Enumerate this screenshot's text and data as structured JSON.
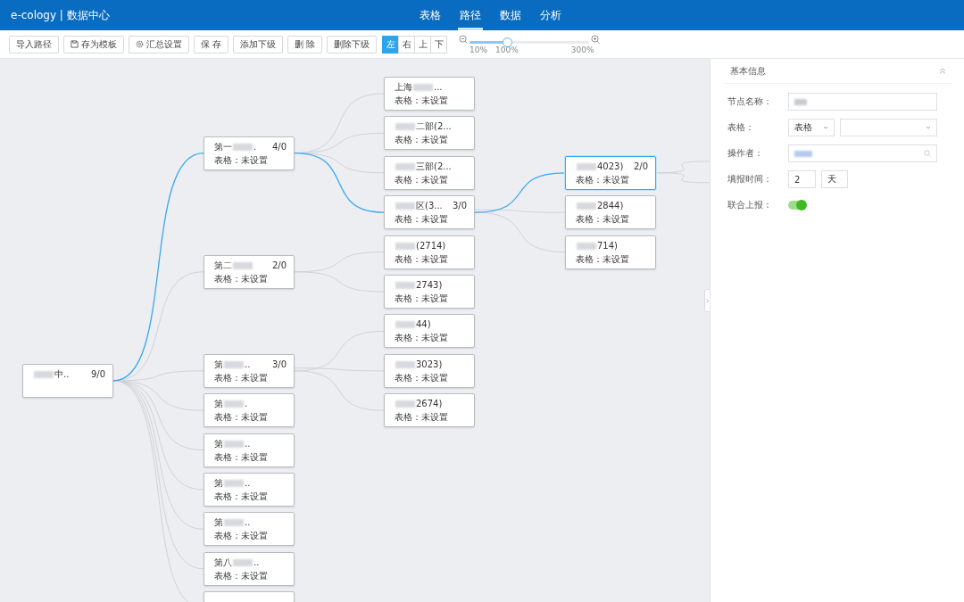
{
  "header": {
    "title": "e-cology | 数据中心",
    "tabs": [
      {
        "label": "表格",
        "selected": false
      },
      {
        "label": "路径",
        "selected": true
      },
      {
        "label": "数据",
        "selected": false
      },
      {
        "label": "分析",
        "selected": false
      }
    ]
  },
  "toolbar": {
    "buttons": [
      {
        "label": "导入路径"
      },
      {
        "label": "存为模板"
      },
      {
        "label": "汇总设置"
      },
      {
        "label": "保 存"
      },
      {
        "label": "添加下级"
      },
      {
        "label": "删 除"
      },
      {
        "label": "删除下级"
      }
    ],
    "directions": [
      {
        "label": "左",
        "selected": true
      },
      {
        "label": "右",
        "selected": false
      },
      {
        "label": "上",
        "selected": false
      },
      {
        "label": "下",
        "selected": false
      }
    ],
    "zoom": {
      "level": 0.31,
      "ticks": [
        "10%",
        "100%",
        "300%"
      ]
    }
  },
  "tree": {
    "redacted": true,
    "suffix": "中..",
    "count": "9/0",
    "selected": false,
    "children": [
      {
        "prefix": "第一",
        "redacted": true,
        "suffix": ".",
        "count": "4/0",
        "table": "表格：未设置",
        "selected": false,
        "on_path": true,
        "children": [
          {
            "prefix": "上海",
            "redacted": true,
            "suffix": "...",
            "table": "表格：未设置",
            "selected": false,
            "on_path": false
          },
          {
            "redacted": true,
            "suffix": "二部(2...",
            "table": "表格：未设置",
            "selected": false,
            "on_path": false
          },
          {
            "redacted": true,
            "suffix": "三部(2...",
            "table": "表格：未设置",
            "selected": false,
            "on_path": false
          },
          {
            "redacted": true,
            "suffix": "区(3...",
            "count": "3/0",
            "table": "表格：未设置",
            "selected": false,
            "on_path": true,
            "children": [
              {
                "redacted": true,
                "suffix": "4023)",
                "count": "2/0",
                "table": "表格：未设置",
                "selected": true,
                "on_path": true,
                "children_offscreen": true
              },
              {
                "redacted": true,
                "suffix": "2844)",
                "table": "表格：未设置",
                "selected": false,
                "on_path": false
              },
              {
                "redacted": true,
                "suffix": "714)",
                "table": "表格：未设置",
                "selected": false,
                "on_path": false
              }
            ]
          }
        ]
      },
      {
        "prefix": "第二",
        "redacted": true,
        "count": "2/0",
        "table": "表格：未设置",
        "selected": false,
        "on_path": false,
        "children": [
          {
            "redacted": true,
            "suffix": "(2714)",
            "table": "表格：未设置",
            "selected": false,
            "on_path": false
          },
          {
            "redacted": true,
            "suffix": "2743)",
            "table": "表格：未设置",
            "selected": false,
            "on_path": false
          }
        ]
      },
      {
        "prefix": "第",
        "redacted": true,
        "suffix": "..",
        "count": "3/0",
        "table": "表格：未设置",
        "selected": false,
        "on_path": false,
        "children": [
          {
            "redacted": true,
            "suffix": "44)",
            "table": "表格：未设置",
            "selected": false,
            "on_path": false
          },
          {
            "redacted": true,
            "suffix": "3023)",
            "table": "表格：未设置",
            "selected": false,
            "on_path": false
          },
          {
            "redacted": true,
            "suffix": "2674)",
            "table": "表格：未设置",
            "selected": false,
            "on_path": false
          }
        ]
      },
      {
        "prefix": "第",
        "redacted": true,
        "suffix": ".",
        "table": "表格：未设置",
        "selected": false,
        "on_path": false
      },
      {
        "prefix": "第",
        "redacted": true,
        "suffix": "..",
        "table": "表格：未设置",
        "selected": false,
        "on_path": false
      },
      {
        "prefix": "第",
        "redacted": true,
        "suffix": "..",
        "table": "表格：未设置",
        "selected": false,
        "on_path": false
      },
      {
        "prefix": "第",
        "redacted": true,
        "suffix": "..",
        "table": "表格：未设置",
        "selected": false,
        "on_path": false
      },
      {
        "prefix": "第八",
        "redacted": true,
        "suffix": "..",
        "table": "表格：未设置",
        "selected": false,
        "on_path": false
      },
      {
        "selected": false,
        "on_path": false
      }
    ]
  },
  "panel": {
    "title": "基本信息",
    "expanded": true,
    "fields": [
      {
        "kind": "text",
        "label": "节点名称：",
        "redacted": true
      },
      {
        "kind": "select_pair",
        "label": "表格：",
        "value": "表格"
      },
      {
        "kind": "search",
        "label": "操作者：",
        "redacted": true
      },
      {
        "kind": "number_unit",
        "label": "填报时间：",
        "value": "2",
        "unit": "天"
      },
      {
        "kind": "switch",
        "label": "联合上报：",
        "on": true
      }
    ]
  }
}
